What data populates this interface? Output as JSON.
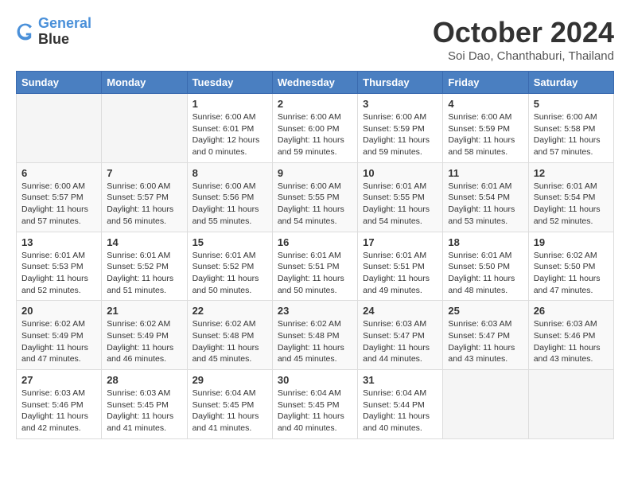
{
  "logo": {
    "line1": "General",
    "line2": "Blue"
  },
  "title": "October 2024",
  "location": "Soi Dao, Chanthaburi, Thailand",
  "weekdays": [
    "Sunday",
    "Monday",
    "Tuesday",
    "Wednesday",
    "Thursday",
    "Friday",
    "Saturday"
  ],
  "weeks": [
    [
      {
        "day": "",
        "info": ""
      },
      {
        "day": "",
        "info": ""
      },
      {
        "day": "1",
        "info": "Sunrise: 6:00 AM\nSunset: 6:01 PM\nDaylight: 12 hours\nand 0 minutes."
      },
      {
        "day": "2",
        "info": "Sunrise: 6:00 AM\nSunset: 6:00 PM\nDaylight: 11 hours\nand 59 minutes."
      },
      {
        "day": "3",
        "info": "Sunrise: 6:00 AM\nSunset: 5:59 PM\nDaylight: 11 hours\nand 59 minutes."
      },
      {
        "day": "4",
        "info": "Sunrise: 6:00 AM\nSunset: 5:59 PM\nDaylight: 11 hours\nand 58 minutes."
      },
      {
        "day": "5",
        "info": "Sunrise: 6:00 AM\nSunset: 5:58 PM\nDaylight: 11 hours\nand 57 minutes."
      }
    ],
    [
      {
        "day": "6",
        "info": "Sunrise: 6:00 AM\nSunset: 5:57 PM\nDaylight: 11 hours\nand 57 minutes."
      },
      {
        "day": "7",
        "info": "Sunrise: 6:00 AM\nSunset: 5:57 PM\nDaylight: 11 hours\nand 56 minutes."
      },
      {
        "day": "8",
        "info": "Sunrise: 6:00 AM\nSunset: 5:56 PM\nDaylight: 11 hours\nand 55 minutes."
      },
      {
        "day": "9",
        "info": "Sunrise: 6:00 AM\nSunset: 5:55 PM\nDaylight: 11 hours\nand 54 minutes."
      },
      {
        "day": "10",
        "info": "Sunrise: 6:01 AM\nSunset: 5:55 PM\nDaylight: 11 hours\nand 54 minutes."
      },
      {
        "day": "11",
        "info": "Sunrise: 6:01 AM\nSunset: 5:54 PM\nDaylight: 11 hours\nand 53 minutes."
      },
      {
        "day": "12",
        "info": "Sunrise: 6:01 AM\nSunset: 5:54 PM\nDaylight: 11 hours\nand 52 minutes."
      }
    ],
    [
      {
        "day": "13",
        "info": "Sunrise: 6:01 AM\nSunset: 5:53 PM\nDaylight: 11 hours\nand 52 minutes."
      },
      {
        "day": "14",
        "info": "Sunrise: 6:01 AM\nSunset: 5:52 PM\nDaylight: 11 hours\nand 51 minutes."
      },
      {
        "day": "15",
        "info": "Sunrise: 6:01 AM\nSunset: 5:52 PM\nDaylight: 11 hours\nand 50 minutes."
      },
      {
        "day": "16",
        "info": "Sunrise: 6:01 AM\nSunset: 5:51 PM\nDaylight: 11 hours\nand 50 minutes."
      },
      {
        "day": "17",
        "info": "Sunrise: 6:01 AM\nSunset: 5:51 PM\nDaylight: 11 hours\nand 49 minutes."
      },
      {
        "day": "18",
        "info": "Sunrise: 6:01 AM\nSunset: 5:50 PM\nDaylight: 11 hours\nand 48 minutes."
      },
      {
        "day": "19",
        "info": "Sunrise: 6:02 AM\nSunset: 5:50 PM\nDaylight: 11 hours\nand 47 minutes."
      }
    ],
    [
      {
        "day": "20",
        "info": "Sunrise: 6:02 AM\nSunset: 5:49 PM\nDaylight: 11 hours\nand 47 minutes."
      },
      {
        "day": "21",
        "info": "Sunrise: 6:02 AM\nSunset: 5:49 PM\nDaylight: 11 hours\nand 46 minutes."
      },
      {
        "day": "22",
        "info": "Sunrise: 6:02 AM\nSunset: 5:48 PM\nDaylight: 11 hours\nand 45 minutes."
      },
      {
        "day": "23",
        "info": "Sunrise: 6:02 AM\nSunset: 5:48 PM\nDaylight: 11 hours\nand 45 minutes."
      },
      {
        "day": "24",
        "info": "Sunrise: 6:03 AM\nSunset: 5:47 PM\nDaylight: 11 hours\nand 44 minutes."
      },
      {
        "day": "25",
        "info": "Sunrise: 6:03 AM\nSunset: 5:47 PM\nDaylight: 11 hours\nand 43 minutes."
      },
      {
        "day": "26",
        "info": "Sunrise: 6:03 AM\nSunset: 5:46 PM\nDaylight: 11 hours\nand 43 minutes."
      }
    ],
    [
      {
        "day": "27",
        "info": "Sunrise: 6:03 AM\nSunset: 5:46 PM\nDaylight: 11 hours\nand 42 minutes."
      },
      {
        "day": "28",
        "info": "Sunrise: 6:03 AM\nSunset: 5:45 PM\nDaylight: 11 hours\nand 41 minutes."
      },
      {
        "day": "29",
        "info": "Sunrise: 6:04 AM\nSunset: 5:45 PM\nDaylight: 11 hours\nand 41 minutes."
      },
      {
        "day": "30",
        "info": "Sunrise: 6:04 AM\nSunset: 5:45 PM\nDaylight: 11 hours\nand 40 minutes."
      },
      {
        "day": "31",
        "info": "Sunrise: 6:04 AM\nSunset: 5:44 PM\nDaylight: 11 hours\nand 40 minutes."
      },
      {
        "day": "",
        "info": ""
      },
      {
        "day": "",
        "info": ""
      }
    ]
  ]
}
